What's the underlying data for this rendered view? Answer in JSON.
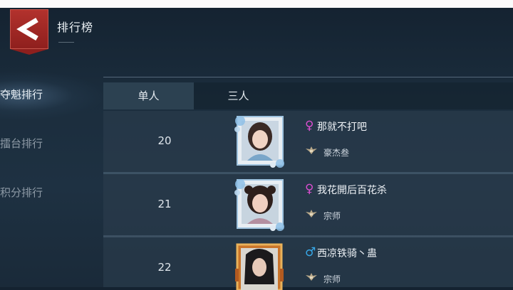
{
  "header": {
    "title": "排行榜"
  },
  "sidebar": {
    "items": [
      {
        "label": "夺魁排行",
        "active": true
      },
      {
        "label": "擂台排行",
        "active": false
      },
      {
        "label": "积分排行",
        "active": false
      }
    ]
  },
  "tabs": [
    {
      "label": "单人",
      "active": true
    },
    {
      "label": "三人",
      "active": false
    }
  ],
  "rows": [
    {
      "rank": "20",
      "gender": "♀",
      "gender_color": "#d94ecf",
      "name": "那就不打吧",
      "title": "豪杰叁"
    },
    {
      "rank": "21",
      "gender": "♀",
      "gender_color": "#d94ecf",
      "name": "我花開后百花杀",
      "title": "宗师"
    },
    {
      "rank": "22",
      "gender": "♂",
      "gender_color": "#37a8e8",
      "name": "西凉铁骑丶蛊",
      "title": "宗师"
    }
  ],
  "colors": {
    "accent_red": "#a42824",
    "female": "#d94ecf",
    "male": "#37a8e8"
  }
}
